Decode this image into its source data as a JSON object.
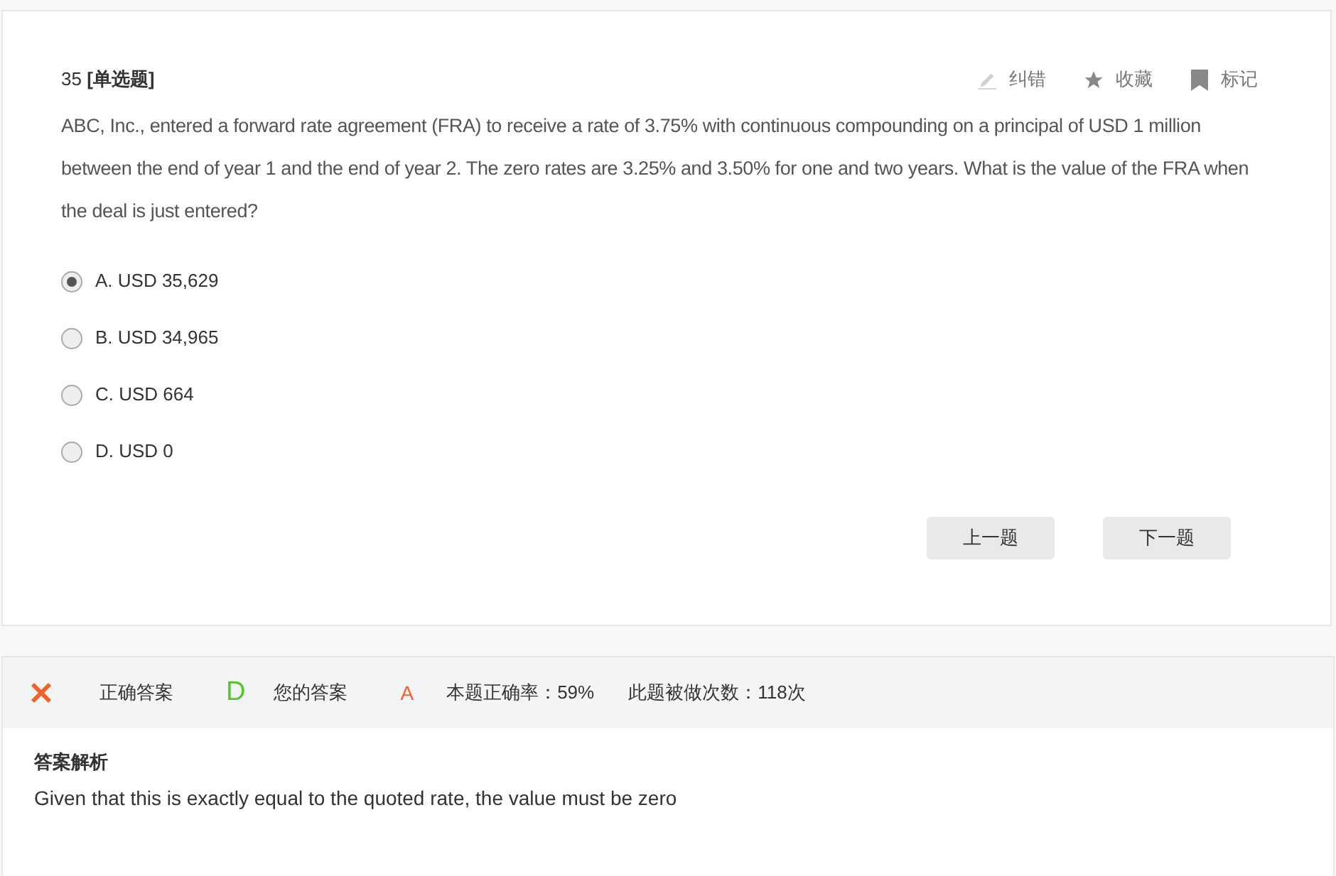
{
  "question": {
    "header": "35 **[单选题]**",
    "actions": [
      {
        "kind": "edit",
        "label": "纠错"
      },
      {
        "kind": "star",
        "label": "收藏"
      },
      {
        "kind": "bookmark",
        "label": "标记"
      }
    ],
    "text": "ABC, Inc., entered a forward rate agreement (FRA) to receive a rate of 3.75% with continuous compounding on a principal of USD 1 million between the end of year 1 and the end of year 2. The zero rates are 3.25% and 3.50% for one and two years. What is the value of the FRA when the deal is just entered?",
    "options": [
      {
        "label": "A. USD 35,629",
        "selected": true
      },
      {
        "label": "B. USD 34,965",
        "selected": false
      },
      {
        "label": "C. USD 664",
        "selected": false
      },
      {
        "label": "D. USD 0",
        "selected": false
      }
    ],
    "buttons": [
      "上一题",
      "下一题"
    ]
  },
  "result": {
    "correct": false,
    "correct_answer_label": "正确答案",
    "correct_answer": "D",
    "your_answer_label": "您的答案",
    "your_answer": "A",
    "accuracy": "本题正确率：59%",
    "attempts": "此题被做次数：118次"
  },
  "explanation": {
    "title": "答案解析",
    "text": "Given that this is exactly equal to the quoted rate, the value must be zero"
  }
}
